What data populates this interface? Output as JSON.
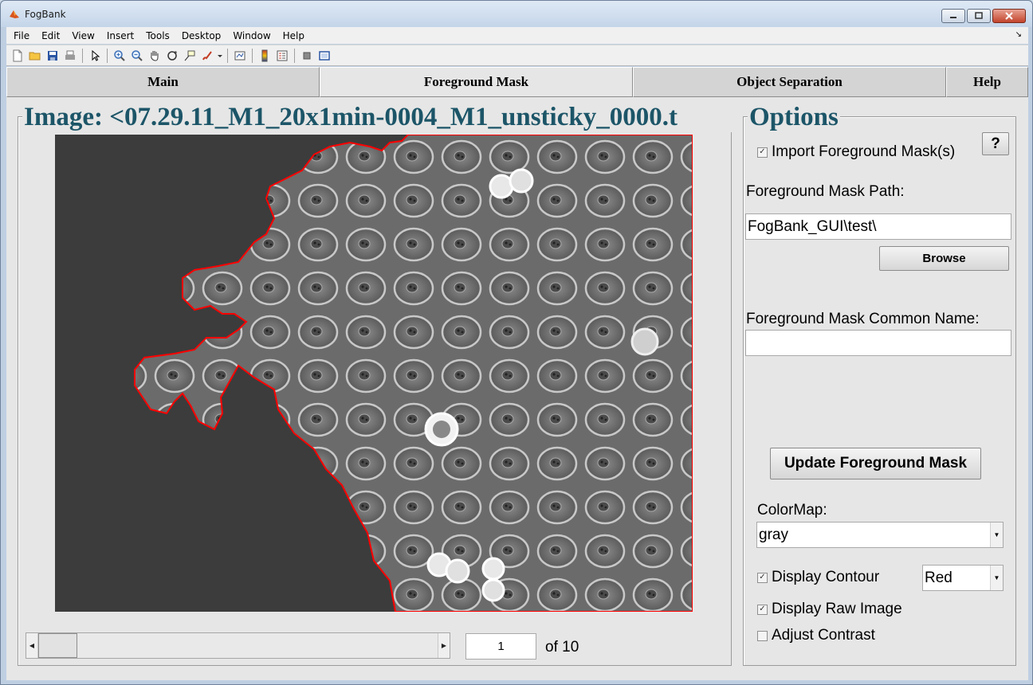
{
  "window": {
    "title": "FogBank"
  },
  "menu": [
    "File",
    "Edit",
    "View",
    "Insert",
    "Tools",
    "Desktop",
    "Window",
    "Help"
  ],
  "toolbar_icons": [
    "new-file-icon",
    "open-folder-icon",
    "save-icon",
    "print-icon",
    "pointer-icon",
    "zoom-in-icon",
    "zoom-out-icon",
    "pan-hand-icon",
    "rotate-3d-icon",
    "data-cursor-icon",
    "brush-icon",
    "dropdown-arrow-icon",
    "link-plot-icon",
    "colorbar-icon",
    "legend-icon",
    "hide-plot-tools-icon",
    "show-plot-tools-icon"
  ],
  "tabs": [
    "Main",
    "Foreground Mask",
    "Object Separation",
    "Help"
  ],
  "active_tab": "Foreground Mask",
  "image_panel": {
    "title": "Image: <07.29.11_M1_20x1min-0004_M1_unsticky_0000.t",
    "page_value": "1",
    "page_of": "of 10"
  },
  "options": {
    "title": "Options",
    "help_button": "?",
    "import_mask_label": "Import Foreground Mask(s)",
    "import_mask_checked": true,
    "mask_path_label": "Foreground Mask Path:",
    "mask_path_value": "FogBank_GUI\\test\\",
    "browse_button": "Browse",
    "common_name_label": "Foreground Mask Common Name:",
    "common_name_value": "",
    "update_button": "Update Foreground Mask",
    "colormap_label": "ColorMap:",
    "colormap_value": "gray",
    "display_contour_label": "Display Contour",
    "display_contour_checked": true,
    "contour_color_value": "Red",
    "display_raw_label": "Display Raw Image",
    "display_raw_checked": true,
    "adjust_contrast_label": "Adjust Contrast",
    "adjust_contrast_checked": false
  },
  "colors": {
    "title_blue": "#1c5568",
    "contour": "#ff0000"
  }
}
